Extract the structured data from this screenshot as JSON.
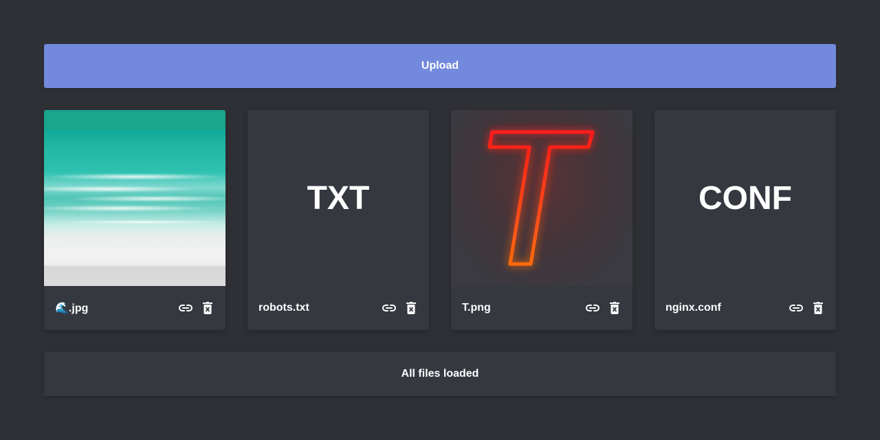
{
  "upload": {
    "label": "Upload"
  },
  "files": [
    {
      "name": "🌊.jpg",
      "preview": "image-beach"
    },
    {
      "name": "robots.txt",
      "preview": "text",
      "type_label": "TXT"
    },
    {
      "name": "T.png",
      "preview": "image-neon-t"
    },
    {
      "name": "nginx.conf",
      "preview": "text",
      "type_label": "CONF"
    }
  ],
  "status": {
    "text": "All files loaded"
  },
  "icons": {
    "link": "link-icon",
    "delete": "delete-icon"
  },
  "colors": {
    "background": "#2f3035",
    "card": "#363840",
    "accent": "#7289dd",
    "neon": "#ff3a1a"
  }
}
